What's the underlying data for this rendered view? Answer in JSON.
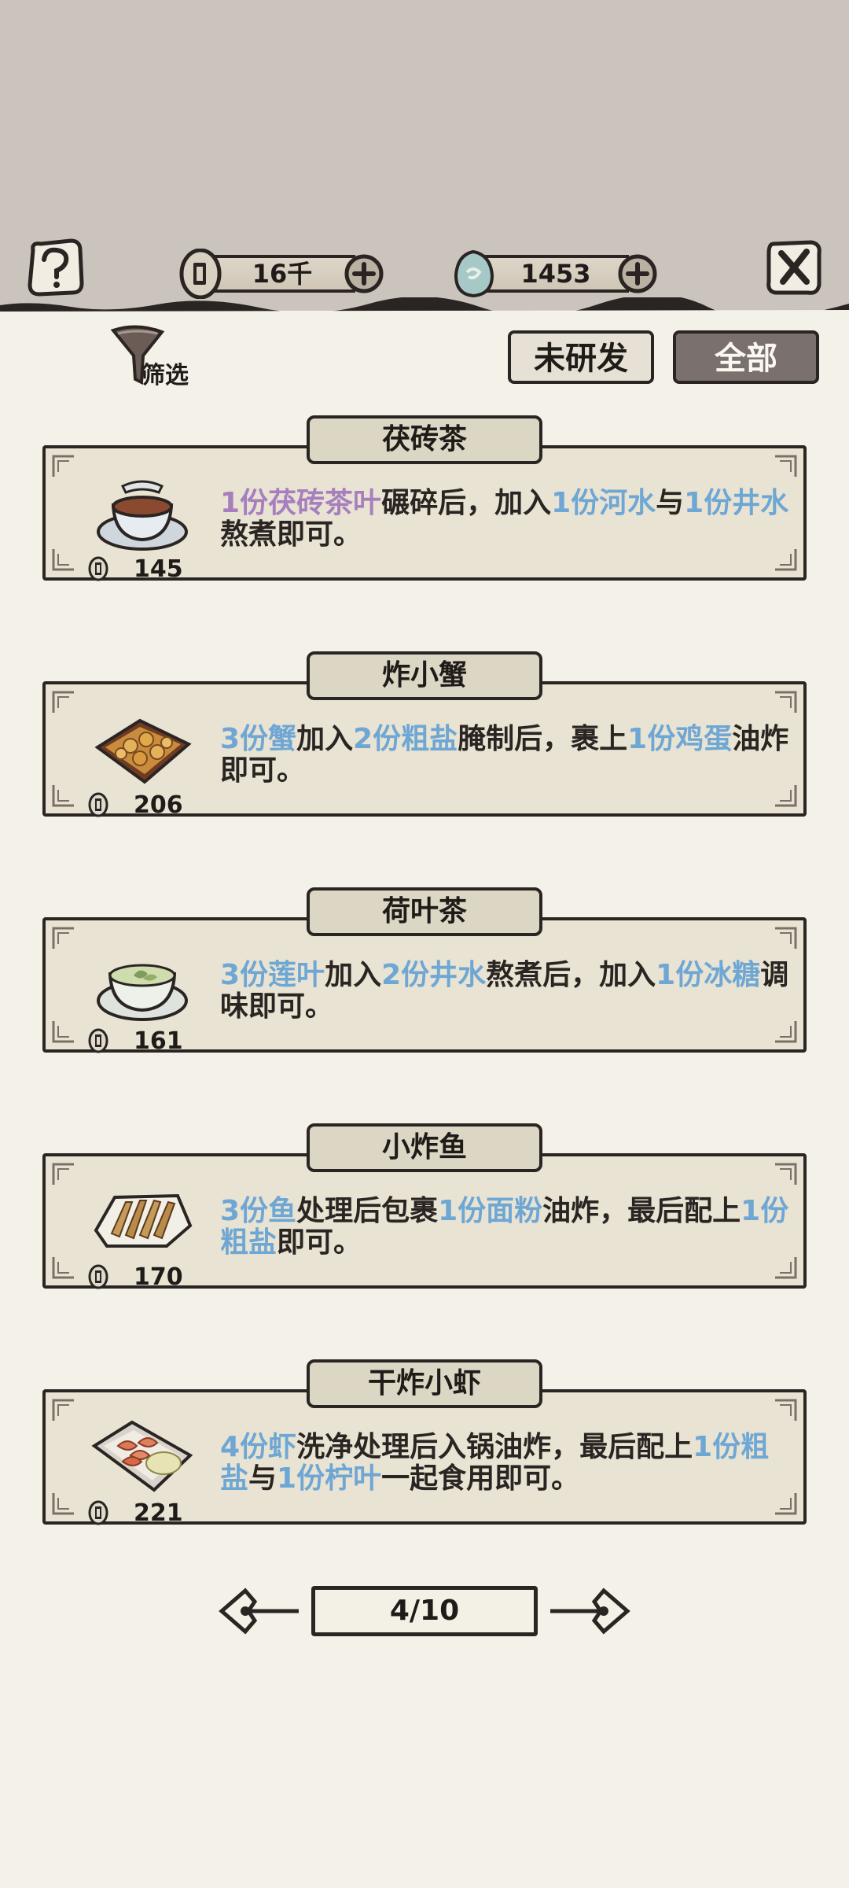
{
  "header": {
    "coins": "16千",
    "gems": "1453"
  },
  "filter": {
    "label": "筛选"
  },
  "tabs": {
    "unresearched": "未研发",
    "all": "全部"
  },
  "recipes": [
    {
      "name": "茯砖茶",
      "price": "145",
      "dish": "tea-cup-dish",
      "desc": [
        {
          "t": "1份茯砖茶叶",
          "c": "purple"
        },
        {
          "t": "碾碎后，加入"
        },
        {
          "t": "1份河水",
          "c": "blue"
        },
        {
          "t": "与"
        },
        {
          "t": "1份井水",
          "c": "blue"
        },
        {
          "t": "熬煮即可。"
        }
      ]
    },
    {
      "name": "炸小蟹",
      "price": "206",
      "dish": "fried-crab-box",
      "desc": [
        {
          "t": "3份蟹",
          "c": "blue"
        },
        {
          "t": "加入"
        },
        {
          "t": "2份粗盐",
          "c": "blue"
        },
        {
          "t": "腌制后，裹上"
        },
        {
          "t": "1份鸡蛋",
          "c": "blue"
        },
        {
          "t": "油炸即可。"
        }
      ]
    },
    {
      "name": "荷叶茶",
      "price": "161",
      "dish": "lotus-tea-bowl",
      "desc": [
        {
          "t": "3份莲叶",
          "c": "blue"
        },
        {
          "t": "加入"
        },
        {
          "t": "2份井水",
          "c": "blue"
        },
        {
          "t": "熬煮后，加入"
        },
        {
          "t": "1份冰糖",
          "c": "blue"
        },
        {
          "t": "调味即可。"
        }
      ]
    },
    {
      "name": "小炸鱼",
      "price": "170",
      "dish": "fried-fish-plate",
      "desc": [
        {
          "t": "3份鱼",
          "c": "blue"
        },
        {
          "t": "处理后包裹"
        },
        {
          "t": "1份面粉",
          "c": "blue"
        },
        {
          "t": "油炸，最后配上"
        },
        {
          "t": "1份粗盐",
          "c": "blue"
        },
        {
          "t": "即可。"
        }
      ]
    },
    {
      "name": "干炸小虾",
      "price": "221",
      "dish": "fried-shrimp-plate",
      "desc": [
        {
          "t": "4份虾",
          "c": "blue"
        },
        {
          "t": "洗净处理后入锅油炸，最后配上"
        },
        {
          "t": "1份粗盐",
          "c": "blue"
        },
        {
          "t": "与"
        },
        {
          "t": "1份柠叶",
          "c": "blue"
        },
        {
          "t": "一起食用即可。"
        }
      ]
    }
  ],
  "pager": {
    "text": "4/10"
  },
  "colors": {
    "blue": "#6ea6d4",
    "purple": "#a77fbf",
    "ink": "#2a2522"
  }
}
